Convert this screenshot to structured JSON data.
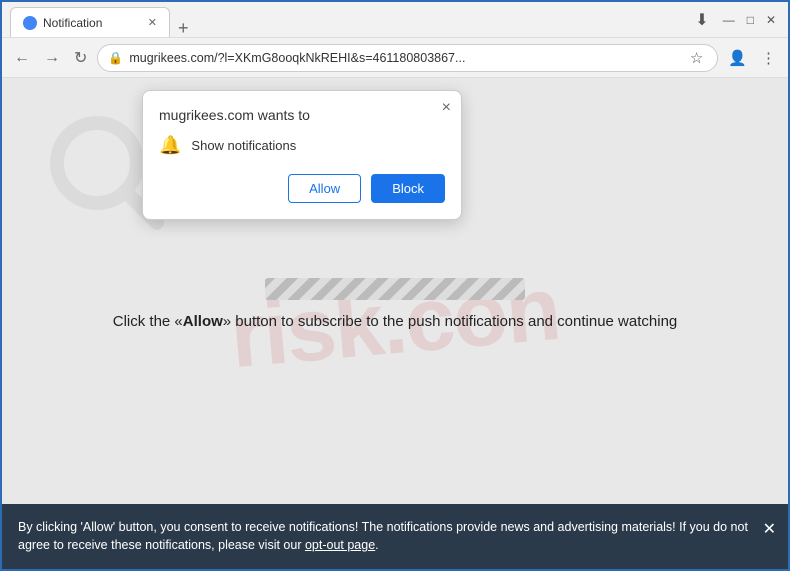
{
  "browser": {
    "tab_title": "Notification",
    "new_tab_label": "+",
    "nav": {
      "back_label": "←",
      "forward_label": "→",
      "refresh_label": "↻",
      "address": "mugrikees.com/?l=XKmG8ooqkNkREHI&s=461180803867...",
      "star_label": "☆",
      "menu_label": "⋮"
    },
    "window_controls": {
      "minimize": "—",
      "maximize": "□",
      "close": "✕"
    }
  },
  "popup": {
    "title": "mugrikees.com wants to",
    "close_label": "×",
    "notification_text": "Show notifications",
    "allow_label": "Allow",
    "block_label": "Block"
  },
  "page": {
    "watermark": "risk.con",
    "main_text_prefix": "Click the «",
    "main_text_bold": "Allow",
    "main_text_suffix": "» button to subscribe to the push notifications and continue watching"
  },
  "bottom_bar": {
    "text_part1": "By clicking 'Allow' button, you consent to receive notifications! The notifications provide news and advertising materials! If you do not agree to receive these notifications, please visit our ",
    "link_text": "opt-out page",
    "text_part2": ".",
    "close_label": "✕"
  }
}
